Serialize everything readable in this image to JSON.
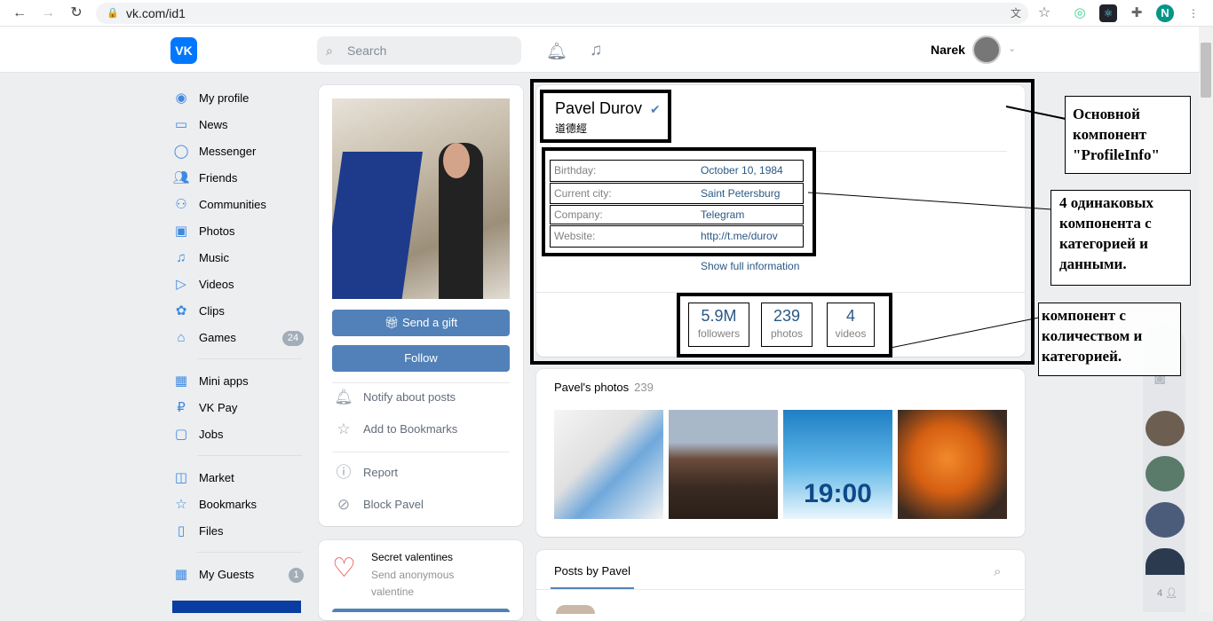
{
  "browser": {
    "url": "vk.com/id1",
    "profile_initial": "N"
  },
  "header": {
    "logo": "VK",
    "search_placeholder": "Search",
    "username": "Narek"
  },
  "sidebar": {
    "items": [
      {
        "label": "My profile",
        "icon": "user-circle-icon"
      },
      {
        "label": "News",
        "icon": "news-icon"
      },
      {
        "label": "Messenger",
        "icon": "chat-icon"
      },
      {
        "label": "Friends",
        "icon": "friends-icon"
      },
      {
        "label": "Communities",
        "icon": "communities-icon"
      },
      {
        "label": "Photos",
        "icon": "photo-icon"
      },
      {
        "label": "Music",
        "icon": "music-icon"
      },
      {
        "label": "Videos",
        "icon": "video-icon"
      },
      {
        "label": "Clips",
        "icon": "clips-icon"
      },
      {
        "label": "Games",
        "icon": "gamepad-icon",
        "badge": "24"
      },
      {
        "label": "Mini apps",
        "icon": "grid-icon"
      },
      {
        "label": "VK Pay",
        "icon": "ruble-icon"
      },
      {
        "label": "Jobs",
        "icon": "briefcase-icon"
      },
      {
        "label": "Market",
        "icon": "bag-icon"
      },
      {
        "label": "Bookmarks",
        "icon": "star-icon"
      },
      {
        "label": "Files",
        "icon": "file-icon"
      },
      {
        "label": "My Guests",
        "icon": "grid-icon",
        "badge": "1"
      }
    ]
  },
  "profile_card": {
    "send_gift": "Send a gift",
    "follow": "Follow",
    "notify": "Notify about posts",
    "bookmarks": "Add to Bookmarks",
    "report": "Report",
    "block": "Block Pavel"
  },
  "valentine": {
    "title": "Secret valentines",
    "subtitle": "Send anonymous valentine"
  },
  "profile_info": {
    "name": "Pavel Durov",
    "status": "道德經",
    "rows": [
      {
        "key": "Birthday:",
        "value": "October 10, 1984"
      },
      {
        "key": "Current city:",
        "value": "Saint Petersburg"
      },
      {
        "key": "Company:",
        "value": "Telegram"
      },
      {
        "key": "Website:",
        "value": "http://t.me/durov"
      }
    ],
    "show_full": "Show full information",
    "counts": [
      {
        "number": "5.9M",
        "label": "followers"
      },
      {
        "number": "239",
        "label": "photos"
      },
      {
        "number": "4",
        "label": "videos"
      }
    ]
  },
  "photos": {
    "title": "Pavel's photos",
    "count": "239",
    "thumb_caption": "19:00"
  },
  "posts": {
    "title": "Posts by Pavel"
  },
  "annotations": {
    "main": "Основной компонент \"ProfileInfo\"",
    "rows": "4 одинаковых компонента с категорией и данными.",
    "counts": "компонент   с количеством и категорией."
  },
  "right_rail": {
    "friends_count": "4"
  }
}
